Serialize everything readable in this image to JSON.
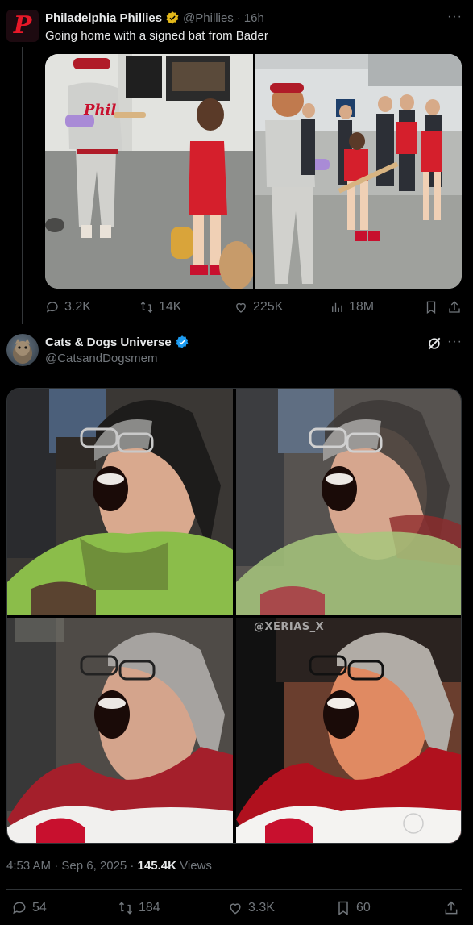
{
  "quoted_post": {
    "author_name": "Philadelphia Phillies",
    "author_handle": "@Phillies",
    "time_ago": "16h",
    "separator": "·",
    "text": "Going home with a signed bat from Bader",
    "avatar_logo_letter": "P",
    "actions": {
      "replies": "3.2K",
      "reposts": "14K",
      "likes": "225K",
      "views": "18M"
    }
  },
  "main_post": {
    "author_name": "Cats & Dogs Universe",
    "author_handle": "@CatsandDogsmem",
    "image_watermark": "@XERIAS_X",
    "timestamp": "4:53 AM · Sep 6, 2025 · ",
    "views_count": "145.4K",
    "views_label": "Views",
    "actions": {
      "replies": "54",
      "reposts": "184",
      "likes": "3.3K",
      "bookmarks": "60"
    }
  },
  "colors": {
    "background": "#000000",
    "text_primary": "#e7e9ea",
    "text_secondary": "#71767b",
    "verified_blue": "#1d9bf0",
    "verified_gold": "#e2b719",
    "phillies_red": "#e81828"
  }
}
